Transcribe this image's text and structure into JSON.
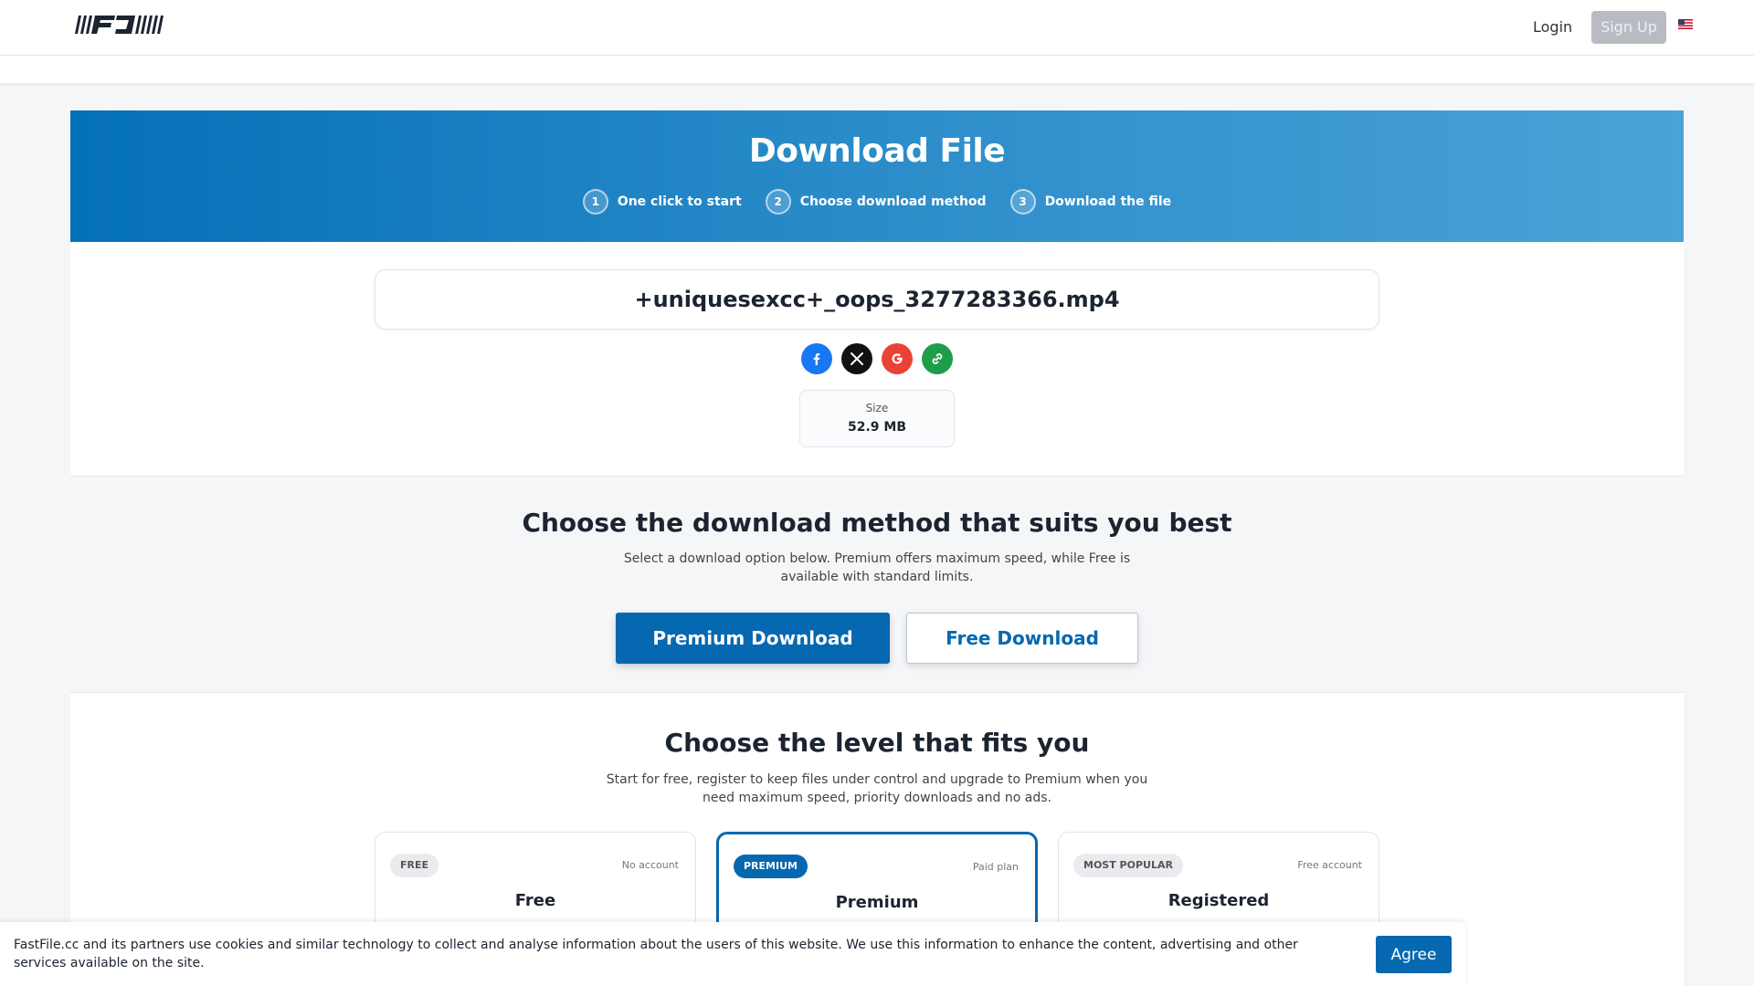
{
  "header": {
    "logo_icon": "fastfile-logo",
    "login": "Login",
    "signup": "Sign Up",
    "language_icon": "us-flag-icon"
  },
  "hero": {
    "title": "Download File",
    "steps": [
      {
        "num": "1",
        "label": "One click to start"
      },
      {
        "num": "2",
        "label": "Choose download method"
      },
      {
        "num": "3",
        "label": "Download the file"
      }
    ]
  },
  "file": {
    "name": "+uniquesexcc+_oops_3277283366.mp4",
    "size_label": "Size",
    "size_value": "52.9 MB"
  },
  "share": [
    "facebook-icon",
    "x-icon",
    "google-icon",
    "link-icon"
  ],
  "method": {
    "title": "Choose the download method that suits you best",
    "subtitle": "Select a download option below. Premium offers maximum speed, while Free is available with standard limits.",
    "premium_label": "Premium Download",
    "free_label": "Free Download"
  },
  "levels": {
    "title": "Choose the level that fits you",
    "subtitle": "Start for free, register to keep files under control and upgrade to Premium when you need maximum speed, priority downloads and no ads.",
    "plans": [
      {
        "badge": "FREE",
        "note": "No account",
        "name": "Free"
      },
      {
        "badge": "PREMIUM",
        "note": "Paid plan",
        "name": "Premium"
      },
      {
        "badge": "MOST POPULAR",
        "note": "Free account",
        "name": "Registered"
      }
    ]
  },
  "cookie": {
    "text": "FastFile.cc and its partners use cookies and similar technology to collect and analyse information about the users of this website. We use this information to enhance the content, advertising and other services available on the site.",
    "agree": "Agree"
  },
  "colors": {
    "brand": "#0568b0",
    "hero_start": "#0470b8",
    "hero_end": "#4aa3d6"
  }
}
